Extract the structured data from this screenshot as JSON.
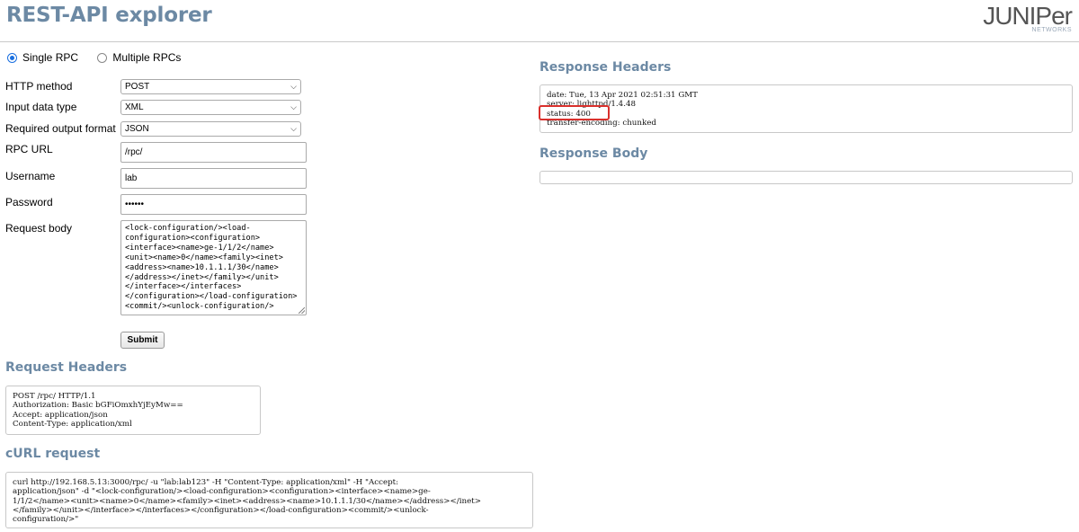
{
  "header": {
    "title": "REST-API explorer",
    "logo_text": "JUNIPer",
    "logo_sub": "NETWORKS"
  },
  "mode": {
    "single_label": "Single RPC",
    "multiple_label": "Multiple RPCs",
    "selected": "Single RPC"
  },
  "form": {
    "http_method": {
      "label": "HTTP method",
      "value": "POST"
    },
    "input_type": {
      "label": "Input data type",
      "value": "XML"
    },
    "output_format": {
      "label": "Required output format",
      "value": "JSON"
    },
    "rpc_url": {
      "label": "RPC URL",
      "value": "/rpc/"
    },
    "username": {
      "label": "Username",
      "value": "lab"
    },
    "password": {
      "label": "Password",
      "value": "••••••"
    },
    "request_body": {
      "label": "Request body",
      "value": "<lock-configuration/><load-\nconfiguration><configuration>\n<interface><name>ge-1/1/2</name>\n<unit><name>0</name><family><inet>\n<address><name>10.1.1.1/30</name>\n</address></inet></family></unit>\n</interface></interfaces>\n</configuration></load-configuration>\n<commit/><unlock-configuration/>"
    },
    "submit_label": "Submit"
  },
  "request_headers": {
    "title": "Request Headers",
    "content": "POST /rpc/ HTTP/1.1\nAuthorization: Basic bGFiOmxhYjEyMw==\nAccept: application/json\nContent-Type: application/xml"
  },
  "curl": {
    "title": "cURL request",
    "content": "curl http://192.168.5.13:3000/rpc/ -u \"lab:lab123\" -H \"Content-Type: application/xml\" -H \"Accept:\napplication/json\" -d \"<lock-configuration/><load-configuration><configuration><interface><name>ge-\n1/1/2</name><unit><name>0</name><family><inet><address><name>10.1.1.1/30</name></address></inet>\n</family></unit></interface></interfaces></configuration></load-configuration><commit/><unlock-\nconfiguration/>\""
  },
  "response_headers": {
    "title": "Response Headers",
    "content": "date: Tue, 13 Apr 2021 02:51:31 GMT\nserver: lighttpd/1.4.48\nstatus: 400\ntransfer-encoding: chunked"
  },
  "response_body": {
    "title": "Response Body",
    "content": ""
  },
  "colors": {
    "heading": "#6c89a4",
    "highlight": "#d9302c",
    "radio_selected": "#1a6fe0"
  }
}
